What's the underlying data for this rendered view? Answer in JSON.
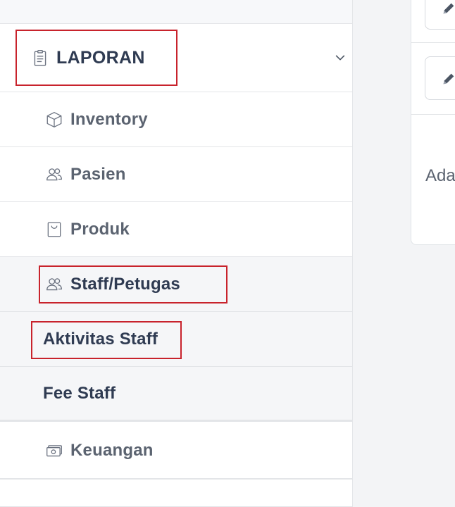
{
  "sidebar": {
    "section": {
      "label": "LAPORAN",
      "icon": "clipboard-icon"
    },
    "items": [
      {
        "label": "Inventory",
        "icon": "cube-icon"
      },
      {
        "label": "Pasien",
        "icon": "users-icon"
      },
      {
        "label": "Produk",
        "icon": "bag-icon"
      },
      {
        "label": "Staff/Petugas",
        "icon": "users-icon"
      },
      {
        "label": "Aktivitas Staff"
      },
      {
        "label": "Fee Staff"
      },
      {
        "label": "Keuangan",
        "icon": "money-icon"
      }
    ]
  },
  "panel": {
    "text": "Ada"
  },
  "colors": {
    "highlight_border": "#c8232c",
    "text_dark": "#2f3b52",
    "text_muted": "#5b6370"
  }
}
